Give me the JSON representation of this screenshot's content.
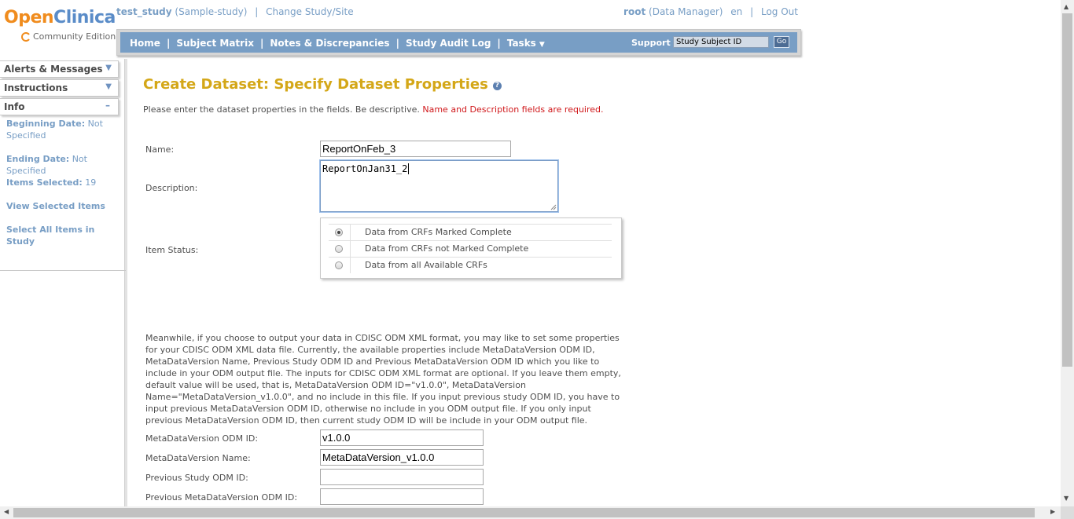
{
  "logo": {
    "word_open": "Open",
    "word_clinica": "Clinica",
    "edition": "Community Edition"
  },
  "header": {
    "study_name": "test_study",
    "study_paren": "(Sample-study)",
    "change_study": "Change Study/Site",
    "user": "root",
    "role": "(Data Manager)",
    "lang": "en",
    "logout": "Log Out",
    "separator": "|"
  },
  "nav": {
    "items": [
      "Home",
      "Subject Matrix",
      "Notes & Discrepancies",
      "Study Audit Log",
      "Tasks"
    ],
    "support": "Support",
    "search_value": "Study Subject ID",
    "go": "Go",
    "caret": "▼"
  },
  "sidebar": {
    "tabs": [
      {
        "label": "Alerts & Messages",
        "indicator": "▼"
      },
      {
        "label": "Instructions",
        "indicator": "▼"
      },
      {
        "label": "Info",
        "indicator": "–"
      }
    ],
    "info": {
      "beginning_date_key": "Beginning Date:",
      "beginning_date_val": "Not Specified",
      "ending_date_key": "Ending Date:",
      "ending_date_val": "Not Specified",
      "items_selected_key": "Items Selected:",
      "items_selected_val": "19",
      "view_selected": "View Selected Items",
      "select_all": "Select All Items in Study"
    }
  },
  "main": {
    "title": "Create Dataset: Specify Dataset Properties",
    "help_icon": "?",
    "instructions": "Please enter the dataset properties in the fields. Be descriptive.",
    "required_note": "Name and Description fields are required.",
    "name_label": "Name:",
    "name_value": "ReportOnFeb_3",
    "description_label": "Description:",
    "description_value": "ReportOnJan31_2",
    "item_status_label": "Item Status:",
    "status_options": [
      {
        "label": "Data from CRFs Marked Complete",
        "selected": true
      },
      {
        "label": "Data from CRFs not Marked Complete",
        "selected": false
      },
      {
        "label": "Data from all Available CRFs",
        "selected": false
      }
    ],
    "odm_paragraph": "Meanwhile, if you choose to output your data in CDISC ODM XML format, you may like to set some properties for your CDISC ODM XML data file. Currently, the available properties include MetaDataVersion ODM ID, MetaDataVersion Name, Previous Study ODM ID and Previous MetaDataVersion ODM ID which you like to include in your ODM output file. The inputs for CDISC ODM XML format are optional. If you leave them empty, default value will be used, that is, MetaDataVersion ODM ID=\"v1.0.0\", MetaDataVersion Name=\"MetaDataVersion_v1.0.0\", and no include in this file. If you input previous study ODM ID, you have to input previous MetaDataVersion ODM ID, otherwise no include in you ODM output file. If you only input previous MetaDataVersion ODM ID, then current study ODM ID will be include in your ODM output file.",
    "mdv_id_label": "MetaDataVersion ODM ID:",
    "mdv_id_value": "v1.0.0",
    "mdv_name_label": "MetaDataVersion Name:",
    "mdv_name_value": "MetaDataVersion_v1.0.0",
    "prev_study_label": "Previous Study ODM ID:",
    "prev_study_value": "",
    "prev_mdv_label": "Previous MetaDataVersion ODM ID:",
    "prev_mdv_value": ""
  },
  "colors": {
    "title": "#d4a718",
    "nav_bg": "#789ec5",
    "link": "#789ec5",
    "required": "#d0181b"
  }
}
